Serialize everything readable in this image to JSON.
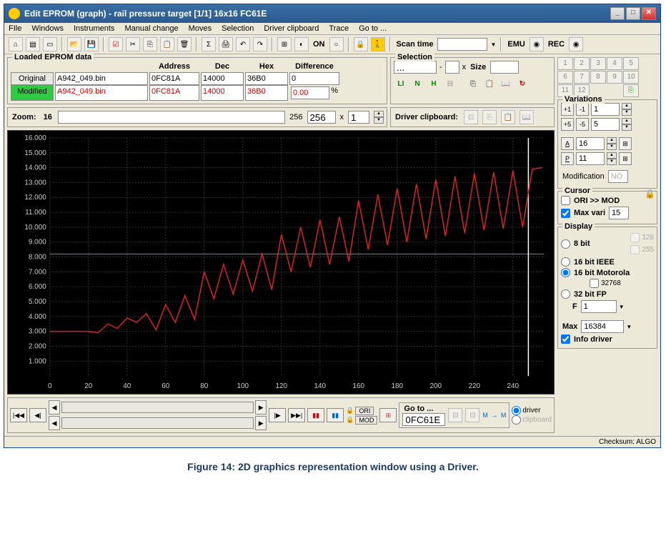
{
  "title": "Edit EPROM (graph) - rail pressure target  [1/1]  16x16  FC61E",
  "menu": [
    "FIle",
    "Windows",
    "Instruments",
    "Manual change",
    "Moves",
    "Selection",
    "Driver clipboard",
    "Trace",
    "Go to ..."
  ],
  "toolbar": {
    "on": "ON",
    "scan": "Scan time",
    "emu": "EMU",
    "rec": "REC"
  },
  "loaded": {
    "title": "Loaded EPROM data",
    "headers": [
      "",
      "Address",
      "Dec",
      "Hex",
      "Difference"
    ],
    "original_lbl": "Original",
    "modified_lbl": "Modified",
    "original": {
      "file": "A942_049.bin",
      "address": "0FC81A",
      "dec": "14000",
      "hex": "36B0",
      "diff": "0"
    },
    "modified": {
      "file": "A942_049.bin",
      "address": "0FC81A",
      "dec": "14000",
      "hex": "36B0",
      "diff": "0.00"
    },
    "pct": "%"
  },
  "selection": {
    "title": "Selection",
    "dots": "...",
    "dash": "-",
    "x": "x",
    "size": "Size"
  },
  "numpad": [
    "1",
    "2",
    "3",
    "4",
    "5",
    "6",
    "7",
    "8",
    "9",
    "10",
    "11",
    "12"
  ],
  "zoom": {
    "label": "Zoom:",
    "val": "16",
    "max": "256",
    "cur": "256",
    "mult": "x",
    "one": "1"
  },
  "driver_cb": "Driver clipboard:",
  "variations": {
    "title": "Variations",
    "v1": "1",
    "v5": "5",
    "v16": "16",
    "v11": "11",
    "modif_lbl": "Modification",
    "modif_val": "NO"
  },
  "cursor": {
    "title": "Cursor",
    "ori": "ORI >> MOD",
    "max": "Max vari",
    "maxval": "15"
  },
  "display": {
    "title": "Display",
    "bit8": "8 bit",
    "v128": "128",
    "v255": "255",
    "ieee": "16 bit IEEE",
    "moto": "16 bit Motorola",
    "v32768": "32768",
    "fp32": "32 bit FP",
    "f": "F",
    "one": "1",
    "max": "Max",
    "maxval": "16384",
    "info": "Info driver"
  },
  "nav": {
    "ori": "ORI",
    "mod": "MOD",
    "goto": "Go to ...",
    "goto_val": "0FC61E",
    "m": "M",
    "driver": "driver",
    "clipboard": "clipboard"
  },
  "status": "Checksum: ALGO",
  "caption": "Figure 14: 2D graphics representation window using a Driver.",
  "chart_data": {
    "type": "line",
    "xlabel": "",
    "ylabel": "",
    "xlim": [
      0,
      256
    ],
    "ylim": [
      0,
      16.0
    ],
    "xticks": [
      0,
      20,
      40,
      60,
      80,
      100,
      120,
      140,
      160,
      180,
      200,
      220,
      240
    ],
    "yticks": [
      1.0,
      2.0,
      3.0,
      4.0,
      5.0,
      6.0,
      7.0,
      8.0,
      9.0,
      10.0,
      11.0,
      12.0,
      13.0,
      14.0,
      15.0,
      16.0
    ],
    "baseline_y": 8.2,
    "series": [
      {
        "name": "modified",
        "color": "#dd2222",
        "x": [
          0,
          5,
          10,
          15,
          20,
          25,
          30,
          35,
          40,
          45,
          50,
          55,
          60,
          65,
          70,
          75,
          80,
          85,
          90,
          95,
          100,
          105,
          110,
          115,
          120,
          125,
          130,
          135,
          140,
          145,
          150,
          155,
          160,
          165,
          170,
          175,
          180,
          185,
          190,
          195,
          200,
          205,
          210,
          215,
          220,
          225,
          230,
          235,
          240,
          245,
          250,
          255
        ],
        "y": [
          3.0,
          3.0,
          3.0,
          3.0,
          3.0,
          2.9,
          3.5,
          3.2,
          3.9,
          3.6,
          4.2,
          3.1,
          4.8,
          3.6,
          5.4,
          3.8,
          7.0,
          5.2,
          7.5,
          5.5,
          7.8,
          5.7,
          8.2,
          5.8,
          9.5,
          7.0,
          10.0,
          7.3,
          10.5,
          7.5,
          10.7,
          7.7,
          11.8,
          8.5,
          12.2,
          8.8,
          12.6,
          9.0,
          12.9,
          9.2,
          13.2,
          9.4,
          13.4,
          9.6,
          13.6,
          9.8,
          13.7,
          9.9,
          13.8,
          10.0,
          13.9,
          14.0
        ]
      }
    ]
  }
}
